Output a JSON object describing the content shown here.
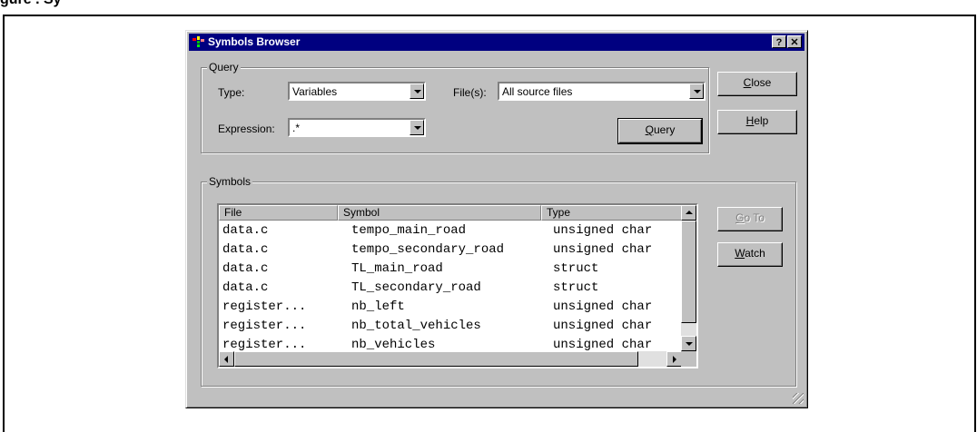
{
  "page": {
    "caption": "gure . Sy"
  },
  "window": {
    "title": "Symbols Browser",
    "help_btn": "?",
    "close_btn": "✕"
  },
  "query": {
    "group_label": "Query",
    "type_label": "Type:",
    "type_value": "Variables",
    "files_label": "File(s):",
    "files_value": "All source files",
    "expression_label": "Expression:",
    "expression_value": ".*",
    "query_btn_mn": "Q",
    "query_btn_rest": "uery"
  },
  "buttons": {
    "close_mn": "C",
    "close_rest": "lose",
    "help_mn": "H",
    "help_rest": "elp",
    "goto_mn": "G",
    "goto_rest": "o To",
    "watch_mn": "W",
    "watch_rest": "atch"
  },
  "symbols": {
    "group_label": "Symbols",
    "columns": [
      "File",
      "Symbol",
      "Type"
    ],
    "rows": [
      [
        "data.c",
        "tempo_main_road",
        "unsigned char"
      ],
      [
        "data.c",
        "tempo_secondary_road",
        "unsigned char"
      ],
      [
        "data.c",
        "TL_main_road",
        "struct"
      ],
      [
        "data.c",
        "TL_secondary_road",
        "struct"
      ],
      [
        "register...",
        "nb_left",
        "unsigned char"
      ],
      [
        "register...",
        "nb_total_vehicles",
        "unsigned char"
      ],
      [
        "register...",
        "nb_vehicles",
        "unsigned char"
      ]
    ]
  },
  "colors": {
    "titlebar": "#000080",
    "face": "#c0c0c0"
  }
}
